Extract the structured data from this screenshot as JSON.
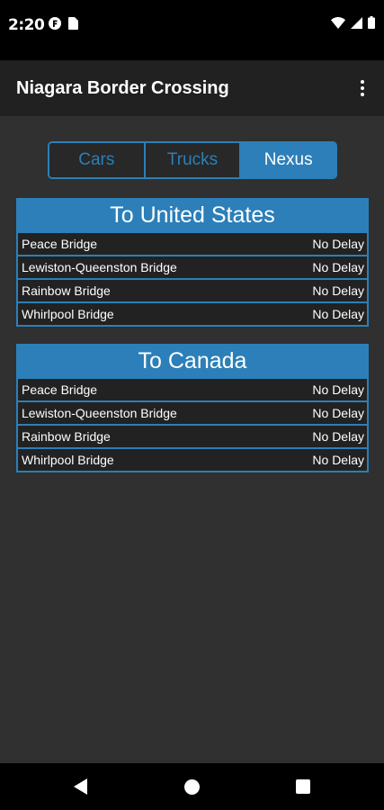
{
  "status_bar": {
    "time": "2:20"
  },
  "app_bar": {
    "title": "Niagara Border Crossing"
  },
  "tabs": [
    {
      "label": "Cars",
      "active": false
    },
    {
      "label": "Trucks",
      "active": false
    },
    {
      "label": "Nexus",
      "active": true
    }
  ],
  "sections": {
    "to_us": {
      "title": "To United States",
      "rows": [
        {
          "bridge": "Peace Bridge",
          "status": "No Delay"
        },
        {
          "bridge": "Lewiston-Queenston Bridge",
          "status": "No Delay"
        },
        {
          "bridge": "Rainbow Bridge",
          "status": "No Delay"
        },
        {
          "bridge": "Whirlpool Bridge",
          "status": "No Delay"
        }
      ]
    },
    "to_canada": {
      "title": "To Canada",
      "rows": [
        {
          "bridge": "Peace Bridge",
          "status": "No Delay"
        },
        {
          "bridge": "Lewiston-Queenston Bridge",
          "status": "No Delay"
        },
        {
          "bridge": "Rainbow Bridge",
          "status": "No Delay"
        },
        {
          "bridge": "Whirlpool Bridge",
          "status": "No Delay"
        }
      ]
    }
  },
  "colors": {
    "accent": "#2c7fb8",
    "background": "#303030",
    "app_bar": "#212121",
    "row_background": "#222222"
  },
  "icons": [
    "f-app-icon",
    "sim-card-icon",
    "wifi-icon",
    "cell-signal-icon",
    "battery-icon",
    "overflow-menu-icon",
    "back-icon",
    "home-icon",
    "recents-icon"
  ]
}
